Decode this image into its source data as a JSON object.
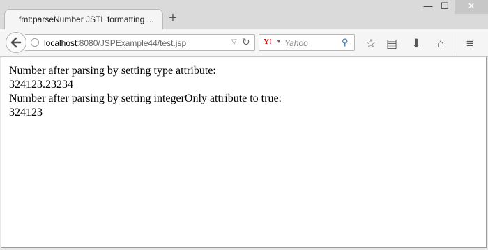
{
  "browser": {
    "tab_title": "fmt:parseNumber JSTL formatting ...",
    "new_tab_label": "+",
    "window_controls": {
      "minimize": "—",
      "maximize": "☐",
      "close": "✕"
    },
    "address": {
      "host": "localhost",
      "path": ":8080/JSPExample44/test.jsp"
    },
    "search": {
      "engine": "Y!",
      "placeholder": "Yahoo"
    },
    "icons": [
      "back-icon",
      "globe-icon",
      "dropdown-icon",
      "reload-icon",
      "search-icon",
      "bookmark-star-icon",
      "reading-list-icon",
      "download-icon",
      "home-icon",
      "menu-icon"
    ]
  },
  "page": {
    "line1": "Number after parsing by setting type attribute:",
    "line2": "324123.23234",
    "line3": "Number after parsing by setting integerOnly attribute to true:",
    "line4": "324123"
  }
}
